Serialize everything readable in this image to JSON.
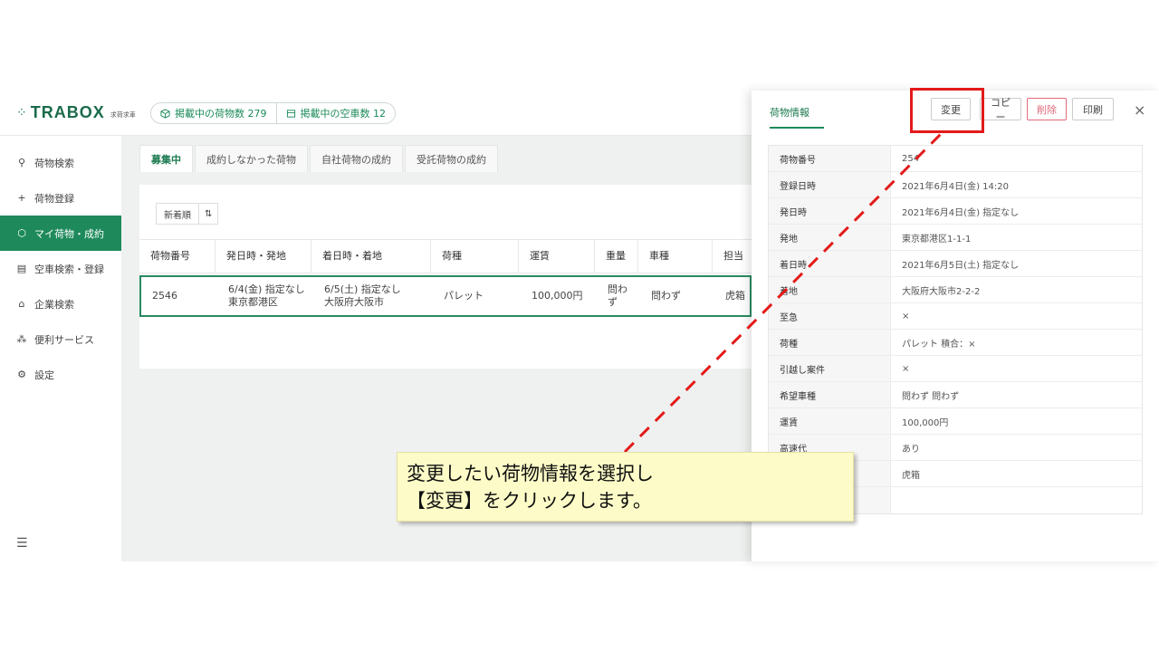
{
  "brand": {
    "logo": "TRABOX",
    "sub": "求荷求車"
  },
  "header": {
    "cargo_count": "掲載中の荷物数 279",
    "truck_count": "掲載中の空車数 12"
  },
  "sidebar": {
    "items": [
      {
        "label": "荷物検索",
        "icon": "search-icon"
      },
      {
        "label": "荷物登録",
        "icon": "plus-icon"
      },
      {
        "label": "マイ荷物・成約",
        "icon": "box-icon"
      },
      {
        "label": "空車検索・登録",
        "icon": "truck-icon"
      },
      {
        "label": "企業検索",
        "icon": "home-icon"
      },
      {
        "label": "便利サービス",
        "icon": "network-icon"
      },
      {
        "label": "設定",
        "icon": "gear-icon"
      }
    ]
  },
  "tabs": [
    "募集中",
    "成約しなかった荷物",
    "自社荷物の成約",
    "受託荷物の成約"
  ],
  "sort": {
    "label": "新着順"
  },
  "table": {
    "headers": [
      "荷物番号",
      "発日時・発地",
      "着日時・着地",
      "荷種",
      "運賃",
      "重量",
      "車種",
      "担当"
    ],
    "row": {
      "id": "2546",
      "depart_date": "6/4(金) 指定なし",
      "depart_place": "東京都港区",
      "arrive_date": "6/5(土) 指定なし",
      "arrive_place": "大阪府大阪市",
      "cargo": "パレット",
      "fare": "100,000円",
      "weight": "問わず",
      "vehicle": "問わず",
      "person": "虎箱"
    }
  },
  "drawer": {
    "tab": "荷物情報",
    "buttons": {
      "edit": "変更",
      "copy": "コピー",
      "delete": "削除",
      "print": "印刷",
      "close": "×"
    },
    "rows": [
      {
        "label": "荷物番号",
        "value": "254"
      },
      {
        "label": "登録日時",
        "value": "2021年6月4日(金) 14:20"
      },
      {
        "label": "発日時",
        "value": "2021年6月4日(金) 指定なし"
      },
      {
        "label": "発地",
        "value": "東京都港区1-1-1"
      },
      {
        "label": "着日時",
        "value": "2021年6月5日(土) 指定なし"
      },
      {
        "label": "着地",
        "value": "大阪府大阪市2-2-2"
      },
      {
        "label": "至急",
        "value": "×"
      },
      {
        "label": "荷種",
        "value": "パレット 積合：×"
      },
      {
        "label": "引越し案件",
        "value": "×"
      },
      {
        "label": "希望車種",
        "value": "問わず 問わず"
      },
      {
        "label": "運賃",
        "value": "100,000円"
      },
      {
        "label": "高速代",
        "value": "あり"
      },
      {
        "label": "",
        "value": "虎箱"
      },
      {
        "label": "",
        "value": ""
      }
    ]
  },
  "callout": {
    "line1": "変更したい荷物情報を選択し",
    "line2": "【変更】をクリックします。"
  },
  "colors": {
    "accent": "#1e8a5b",
    "highlight": "#e31a1a",
    "callout_bg": "#fdfcc8"
  }
}
